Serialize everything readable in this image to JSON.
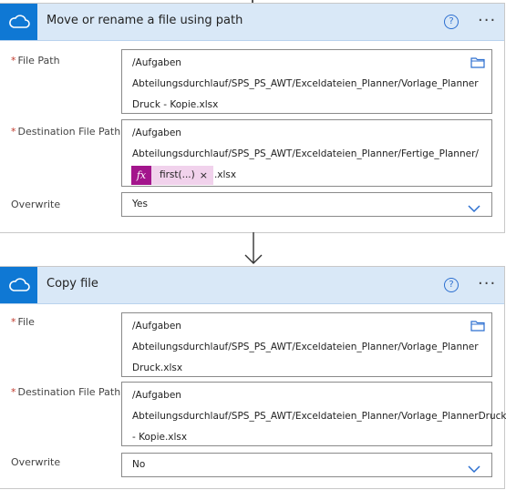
{
  "card1": {
    "title": "Move or rename a file using path",
    "help_glyph": "?",
    "more_glyph": "···",
    "file_path_label": "File Path",
    "file_path_lines": [
      "/Aufgaben",
      "Abteilungsdurchlauf/SPS_PS_AWT/Exceldateien_Planner/Vorlage_Planner",
      "Druck - Kopie.xlsx"
    ],
    "dest_label": "Destination File Path",
    "dest_lines": [
      "/Aufgaben",
      "Abteilungsdurchlauf/SPS_PS_AWT/Exceldateien_Planner/Fertige_Planner/"
    ],
    "dest_token_fx": "fx",
    "dest_token_text": "first(...)",
    "dest_token_close": "×",
    "dest_suffix": ".xlsx",
    "overwrite_label": "Overwrite",
    "overwrite_value": "Yes"
  },
  "card2": {
    "title": "Copy file",
    "help_glyph": "?",
    "more_glyph": "···",
    "file_label": "File",
    "file_lines": [
      "/Aufgaben",
      "Abteilungsdurchlauf/SPS_PS_AWT/Exceldateien_Planner/Vorlage_Planner",
      "Druck.xlsx"
    ],
    "dest_label": "Destination File Path",
    "dest_lines": [
      "/Aufgaben",
      "Abteilungsdurchlauf/SPS_PS_AWT/Exceldateien_Planner/Vorlage_PlannerDruck",
      "- Kopie.xlsx"
    ],
    "overwrite_label": "Overwrite",
    "overwrite_value": "No"
  },
  "icons": {
    "connector": "onedrive-cloud-icon",
    "folder": "folder-icon",
    "chevron": "chevron-down-icon",
    "arrow": "down-arrow-icon"
  },
  "colors": {
    "accent": "#0f78d4",
    "header_bg": "#d9e8f7",
    "token": "#a3158c",
    "token_bg": "#f1d2ec"
  }
}
